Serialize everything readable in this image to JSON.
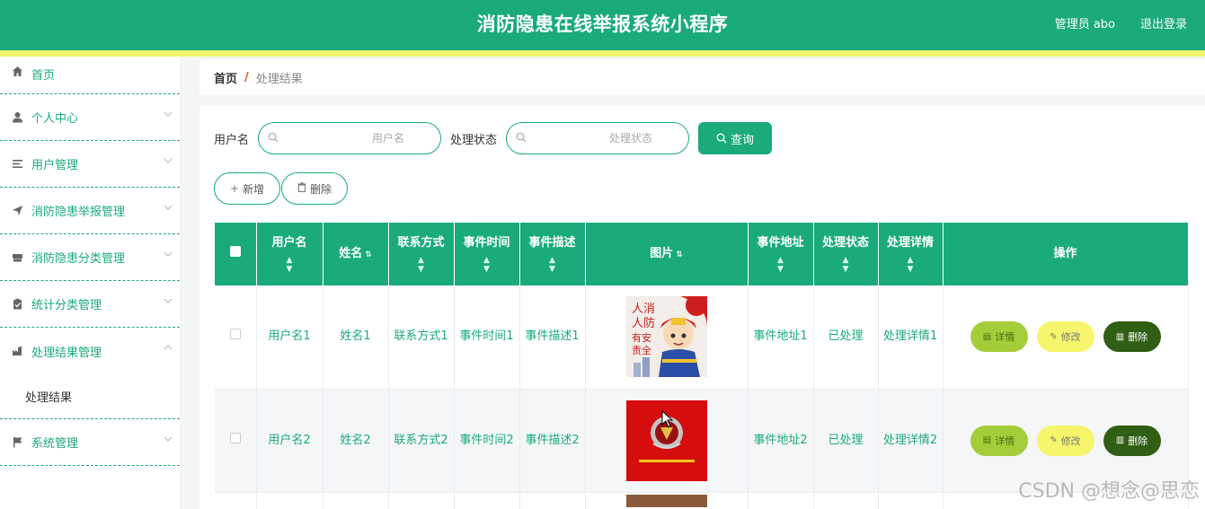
{
  "header": {
    "title": "消防隐患在线举报系统小程序",
    "user": "管理员 abo",
    "logout": "退出登录"
  },
  "sidebar": {
    "items": [
      {
        "label": "首页",
        "icon": "home-icon"
      },
      {
        "label": "个人中心",
        "icon": "user-icon"
      },
      {
        "label": "用户管理",
        "icon": "list-icon"
      },
      {
        "label": "消防隐患举报管理",
        "icon": "send-icon"
      },
      {
        "label": "消防隐患分类管理",
        "icon": "box-icon"
      },
      {
        "label": "统计分类管理",
        "icon": "clipboard-icon"
      },
      {
        "label": "处理结果管理",
        "icon": "factory-icon"
      },
      {
        "label": "系统管理",
        "icon": "flag-icon"
      }
    ],
    "subitem": "处理结果"
  },
  "breadcrumb": {
    "home": "首页",
    "sep": "/",
    "current": "处理结果"
  },
  "search": {
    "username_label": "用户名",
    "username_placeholder": "用户名",
    "status_label": "处理状态",
    "status_placeholder": "处理状态",
    "query_button": "查询"
  },
  "actions": {
    "add": "新增",
    "delete": "删除"
  },
  "table": {
    "headers": [
      "用户名",
      "姓名",
      "联系方式",
      "事件时间",
      "事件描述",
      "图片",
      "事件地址",
      "处理状态",
      "处理详情",
      "操作"
    ],
    "rows": [
      {
        "username": "用户名1",
        "name": "姓名1",
        "contact": "联系方式1",
        "time": "事件时间1",
        "desc": "事件描述1",
        "address": "事件地址1",
        "status": "已处理",
        "detail": "处理详情1"
      },
      {
        "username": "用户名2",
        "name": "姓名2",
        "contact": "联系方式2",
        "time": "事件时间2",
        "desc": "事件描述2",
        "address": "事件地址2",
        "status": "已处理",
        "detail": "处理详情2"
      }
    ],
    "row_ops": {
      "detail": "详情",
      "edit": "修改",
      "delete": "删除"
    }
  },
  "colors": {
    "primary": "#1aaa7c",
    "accent_yellow": "#f7f56b",
    "detail_btn": "#a5cd39",
    "delete_btn": "#2f5e14"
  },
  "watermark": "CSDN @想念@思恋"
}
